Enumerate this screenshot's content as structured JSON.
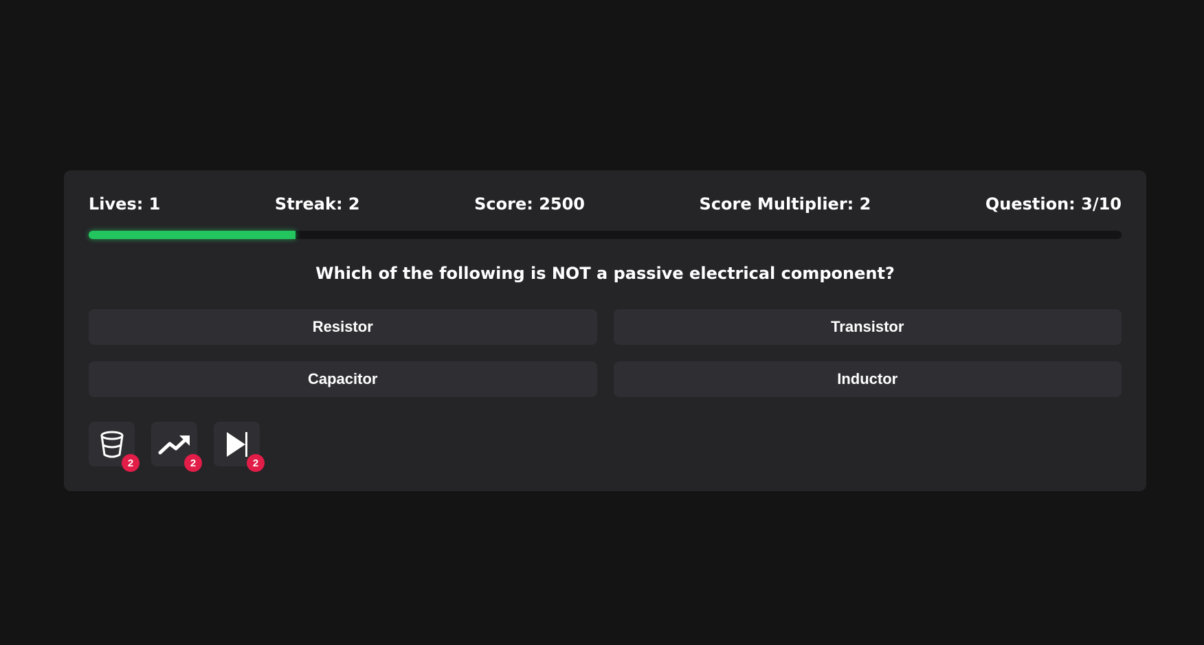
{
  "stats": {
    "lives": "Lives: 1",
    "streak": "Streak: 2",
    "score": "Score: 2500",
    "multiplier": "Score Multiplier: 2",
    "question_progress": "Question: 3/10"
  },
  "progress": {
    "fraction": 0.2,
    "color": "#22c55e"
  },
  "question": {
    "text": "Which of the following is NOT a passive electrical component?"
  },
  "answers": [
    {
      "label": "Resistor"
    },
    {
      "label": "Transistor"
    },
    {
      "label": "Capacitor"
    },
    {
      "label": "Inductor"
    }
  ],
  "powerups": [
    {
      "icon": "bucket-icon",
      "count": "2"
    },
    {
      "icon": "trending-up-icon",
      "count": "2"
    },
    {
      "icon": "skip-forward-icon",
      "count": "2"
    }
  ],
  "colors": {
    "background": "#141414",
    "card": "#252427",
    "answer": "#2f2e32",
    "badge": "#e11d48",
    "accent": "#22c55e"
  }
}
